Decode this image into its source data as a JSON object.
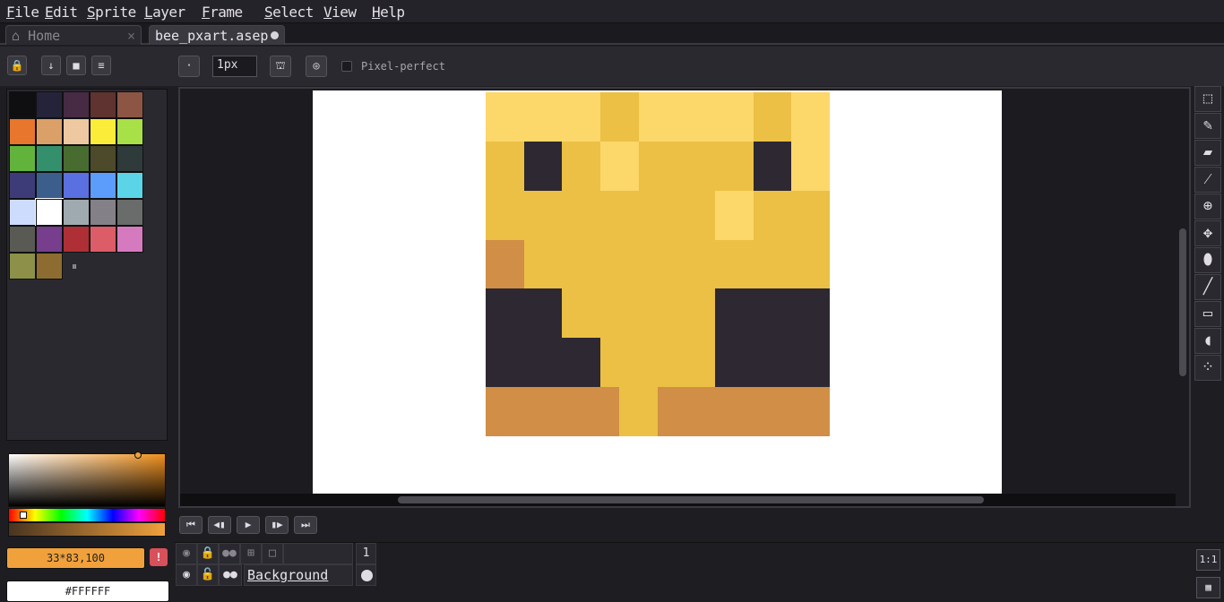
{
  "menu": [
    "File",
    "Edit",
    "Sprite",
    "Layer",
    "Frame",
    "Select",
    "View",
    "Help"
  ],
  "tabs": {
    "home": "Home",
    "file": "bee_pxart.asep"
  },
  "left_tools": {
    "lock_icon": "lock-icon",
    "buttons": [
      "↓",
      "■",
      "≡"
    ]
  },
  "context_bar": {
    "brush_type": "·",
    "brush_size": "1px",
    "pixel_perfect_label": "Pixel-perfect",
    "pixel_perfect_checked": false
  },
  "palette": {
    "colors": [
      "#0f0f11",
      "#25233a",
      "#472a44",
      "#5e3330",
      "#8c5544",
      "#e8762c",
      "#dba068",
      "#eec8a0",
      "#fcec3a",
      "#a8e048",
      "#62b33c",
      "#34906c",
      "#486c30",
      "#4c4a2a",
      "#2f3b3a",
      "#3e3c78",
      "#3c5e8c",
      "#5a6fe0",
      "#5c9cfa",
      "#5cd4e8",
      "#cddcfc",
      "#ffffff",
      "#9faab0",
      "#848088",
      "#6a6c6c",
      "#595a54",
      "#763e8c",
      "#ae2f36",
      "#dc5c68",
      "#d67ac0",
      "#8c9048",
      "#8c6c30"
    ],
    "selected_index": 21,
    "drag_handle": "⏸"
  },
  "color": {
    "rgba_value": "33*83,100",
    "hex_value": "#FFFFFF",
    "accent": "#f0a13c"
  },
  "sprite": {
    "palette": {
      "L": "#fcd76a",
      "Y": "#ebc045",
      "D": "#2e2832",
      "B": "#d08e46"
    },
    "rows": [
      "LLLLLLYYLLLLLLYYLL",
      "LLLLLLYYLLLLLLYYLL",
      "YYDDYYLLYYYYYYDDLL",
      "YYDDYYLLYYYYYYDDLL",
      "YYYYYYYYYYYYLLYYYY",
      "YYYYYYYYYYYYLLYYYY",
      "BBYYYYYYYYYYYYYYYY",
      "BBYYYYYYYYYYYYYYYY",
      "DDDDYYYYYYYYDDDDDD",
      "DDDDYYYYYYYYDDDDDD",
      "DDDDDDYYYYYYDDDDDD",
      "DDDDDDYYYYYYDDDDDD",
      "BBBBBBBYYBBBBBBBBB",
      "BBBBBBBYYBBBBBBBBB"
    ]
  },
  "tools": [
    "marquee-icon",
    "pencil-icon",
    "eraser-icon",
    "eyedropper-icon",
    "zoom-icon",
    "move-icon",
    "fill-icon",
    "line-icon",
    "rectangle-icon",
    "blur-icon",
    "spray-icon"
  ],
  "timeline": {
    "layers": [
      {
        "name": "Background",
        "visible": true,
        "locked": false
      }
    ],
    "frames": [
      "1"
    ],
    "controls": [
      "⏮",
      "◀▮",
      "▶",
      "▮▶",
      "⏭"
    ],
    "zoom_label": "1:1"
  }
}
